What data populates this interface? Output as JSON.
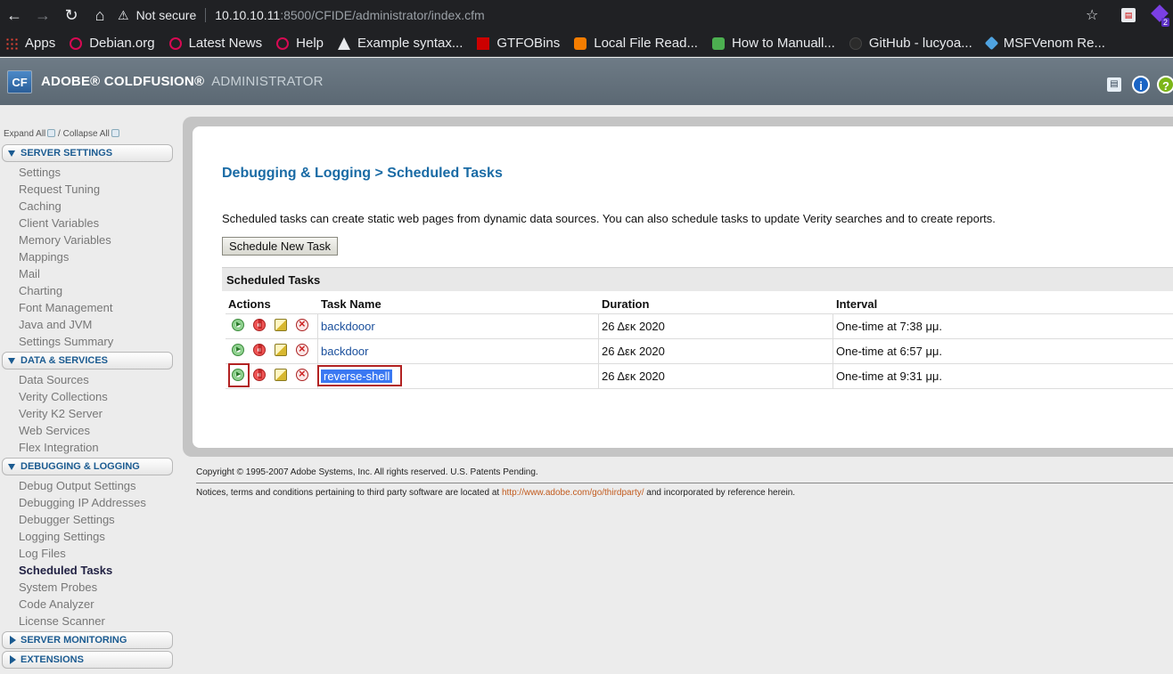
{
  "browser": {
    "security_label": "Not secure",
    "url_host": "10.10.10.11",
    "url_path": ":8500/CFIDE/administrator/index.cfm",
    "extension_badge": "2",
    "bookmarks": [
      {
        "label": "Apps"
      },
      {
        "label": "Debian.org"
      },
      {
        "label": "Latest News"
      },
      {
        "label": "Help"
      },
      {
        "label": "Example syntax..."
      },
      {
        "label": "GTFOBins"
      },
      {
        "label": "Local File Read..."
      },
      {
        "label": "How to Manuall..."
      },
      {
        "label": "GitHub - lucyoa..."
      },
      {
        "label": "MSFVenom Re..."
      }
    ]
  },
  "header": {
    "logo": "CF",
    "brand": "ADOBE® COLDFUSION®",
    "admin": "ADMINISTRATOR"
  },
  "sidebar": {
    "expand_all": "Expand All",
    "separator": "/",
    "collapse_all": "Collapse All",
    "sections": [
      {
        "title": "SERVER SETTINGS",
        "items": [
          "Settings",
          "Request Tuning",
          "Caching",
          "Client Variables",
          "Memory Variables",
          "Mappings",
          "Mail",
          "Charting",
          "Font Management",
          "Java and JVM",
          "Settings Summary"
        ]
      },
      {
        "title": "DATA & SERVICES",
        "items": [
          "Data Sources",
          "Verity Collections",
          "Verity K2 Server",
          "Web Services",
          "Flex Integration"
        ]
      },
      {
        "title": "DEBUGGING & LOGGING",
        "items": [
          "Debug Output Settings",
          "Debugging IP Addresses",
          "Debugger Settings",
          "Logging Settings",
          "Log Files",
          "Scheduled Tasks",
          "System Probes",
          "Code Analyzer",
          "License Scanner"
        ]
      },
      {
        "title": "SERVER MONITORING",
        "items": []
      },
      {
        "title": "EXTENSIONS",
        "items": []
      }
    ]
  },
  "main": {
    "title": "Debugging & Logging > Scheduled Tasks",
    "description": "Scheduled tasks can create static web pages from dynamic data sources. You can also schedule tasks to update Verity searches and to create reports.",
    "new_task_button": "Schedule New Task",
    "table_title": "Scheduled Tasks",
    "columns": [
      "Actions",
      "Task Name",
      "Duration",
      "Interval"
    ],
    "rows": [
      {
        "name": "backdooor",
        "duration": "26 Δεκ 2020",
        "interval": "One-time at 7:38 μμ."
      },
      {
        "name": "backdoor",
        "duration": "26 Δεκ 2020",
        "interval": "One-time at 6:57 μμ."
      },
      {
        "name": "reverse-shell",
        "duration": "26 Δεκ 2020",
        "interval": "One-time at 9:31 μμ."
      }
    ]
  },
  "footer": {
    "copyright": "Copyright © 1995-2007 Adobe Systems, Inc. All rights reserved. U.S. Patents Pending.",
    "notice_pre": "Notices, terms and conditions pertaining to third party software are located at",
    "notice_link": "http://www.adobe.com/go/thirdparty/",
    "notice_post": "and incorporated by reference herein."
  }
}
